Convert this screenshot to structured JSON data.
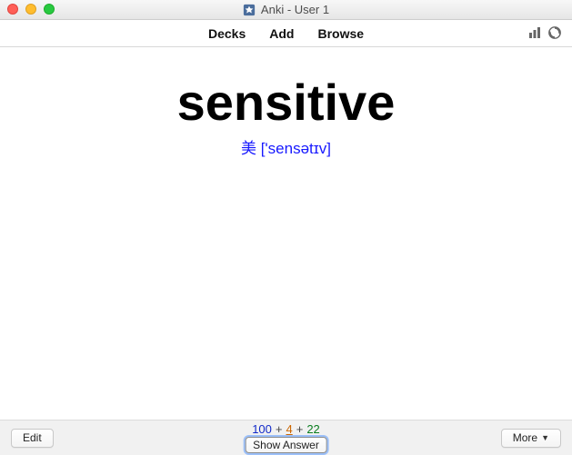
{
  "window": {
    "title": "Anki - User 1"
  },
  "menu": {
    "decks": "Decks",
    "add": "Add",
    "browse": "Browse"
  },
  "icons": {
    "stats": "stats-icon",
    "sync": "sync-icon"
  },
  "card": {
    "front": "sensitive",
    "pronunciation": "美 ['sensətɪv]"
  },
  "counts": {
    "new": "100",
    "learning": "4",
    "review": "22",
    "sep": "+"
  },
  "buttons": {
    "edit": "Edit",
    "show_answer": "Show Answer",
    "more": "More"
  }
}
